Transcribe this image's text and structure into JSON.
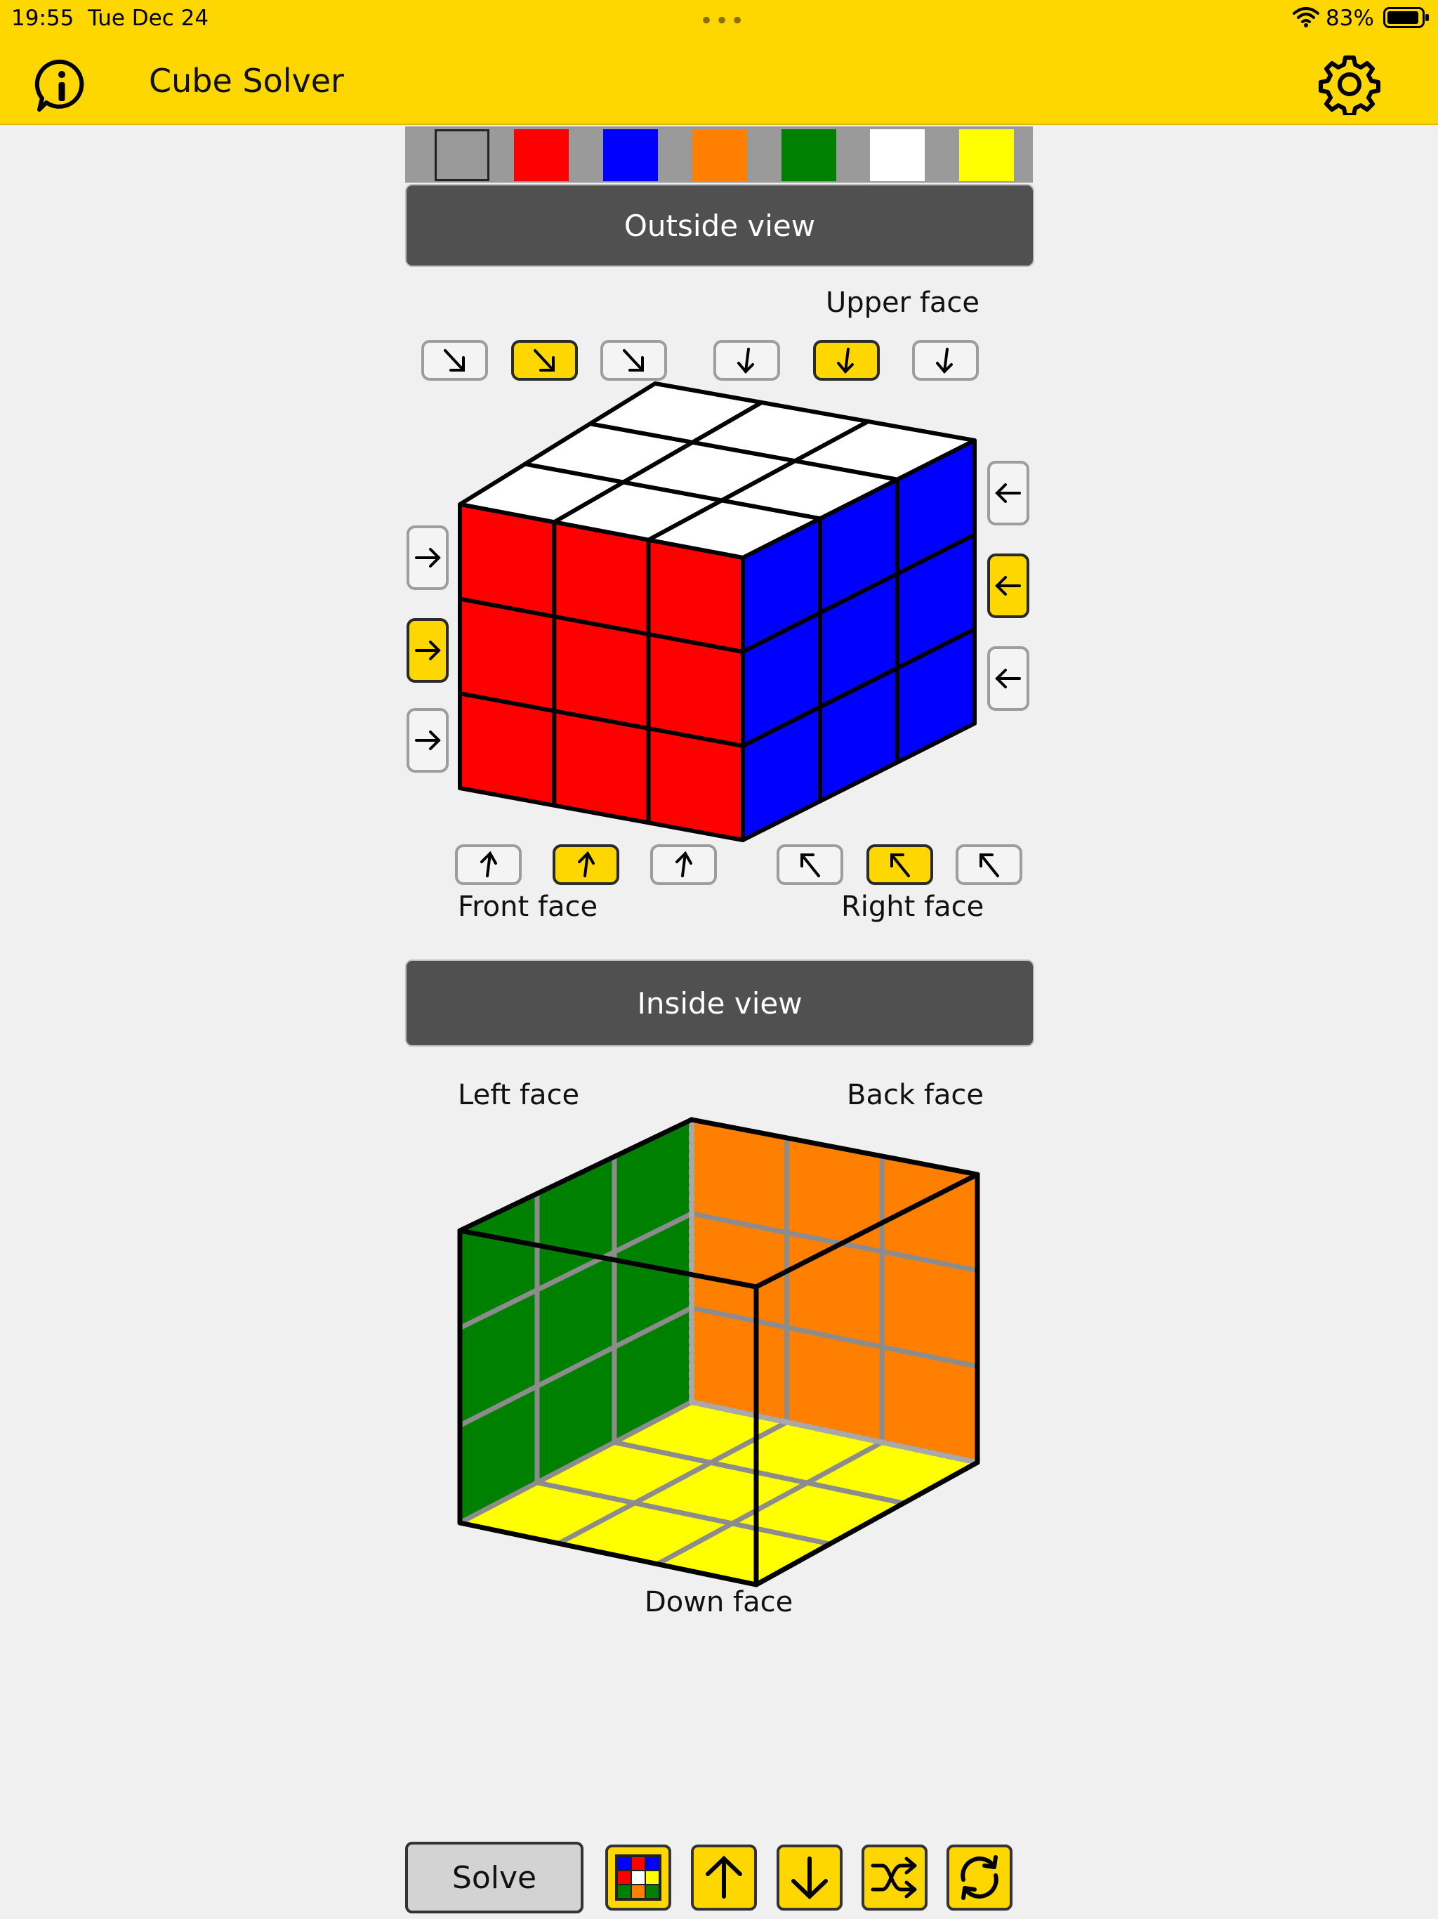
{
  "status_bar": {
    "time": "19:55",
    "date": "Tue Dec 24",
    "battery": "83%"
  },
  "header": {
    "title": "Cube Solver",
    "info_icon": "info-icon",
    "settings_icon": "gear-icon"
  },
  "palette": {
    "colors": [
      "#999999",
      "#ff0000",
      "#0000ff",
      "#ff8000",
      "#008000",
      "#ffffff",
      "#ffff00"
    ],
    "selected_index": 0
  },
  "outside_view": {
    "title": "Outside view",
    "upper_face_label": "Upper face",
    "front_face_label": "Front face",
    "right_face_label": "Right face",
    "upper_face_colors": [
      "#ffffff",
      "#ffffff",
      "#ffffff",
      "#ffffff",
      "#ffffff",
      "#ffffff",
      "#ffffff",
      "#ffffff",
      "#ffffff"
    ],
    "front_face_colors": [
      "#ff0000",
      "#ff0000",
      "#ff0000",
      "#ff0000",
      "#ff0000",
      "#ff0000",
      "#ff0000",
      "#ff0000",
      "#ff0000"
    ],
    "right_face_colors": [
      "#0000ff",
      "#0000ff",
      "#0000ff",
      "#0000ff",
      "#0000ff",
      "#0000ff",
      "#0000ff",
      "#0000ff",
      "#0000ff"
    ]
  },
  "inside_view": {
    "title": "Inside view",
    "left_face_label": "Left face",
    "back_face_label": "Back face",
    "down_face_label": "Down face",
    "left_face_colors": [
      "#008000",
      "#008000",
      "#008000",
      "#008000",
      "#008000",
      "#008000",
      "#008000",
      "#008000",
      "#008000"
    ],
    "back_face_colors": [
      "#ff8000",
      "#ff8000",
      "#ff8000",
      "#ff8000",
      "#ff8000",
      "#ff8000",
      "#ff8000",
      "#ff8000",
      "#ff8000"
    ],
    "down_face_colors": [
      "#ffff00",
      "#ffff00",
      "#ffff00",
      "#ffff00",
      "#ffff00",
      "#ffff00",
      "#ffff00",
      "#ffff00",
      "#ffff00"
    ]
  },
  "toolbar": {
    "solve_label": "Solve",
    "buttons": [
      "color-grid-icon",
      "arrow-up-icon",
      "arrow-down-icon",
      "shuffle-icon",
      "refresh-icon"
    ]
  }
}
